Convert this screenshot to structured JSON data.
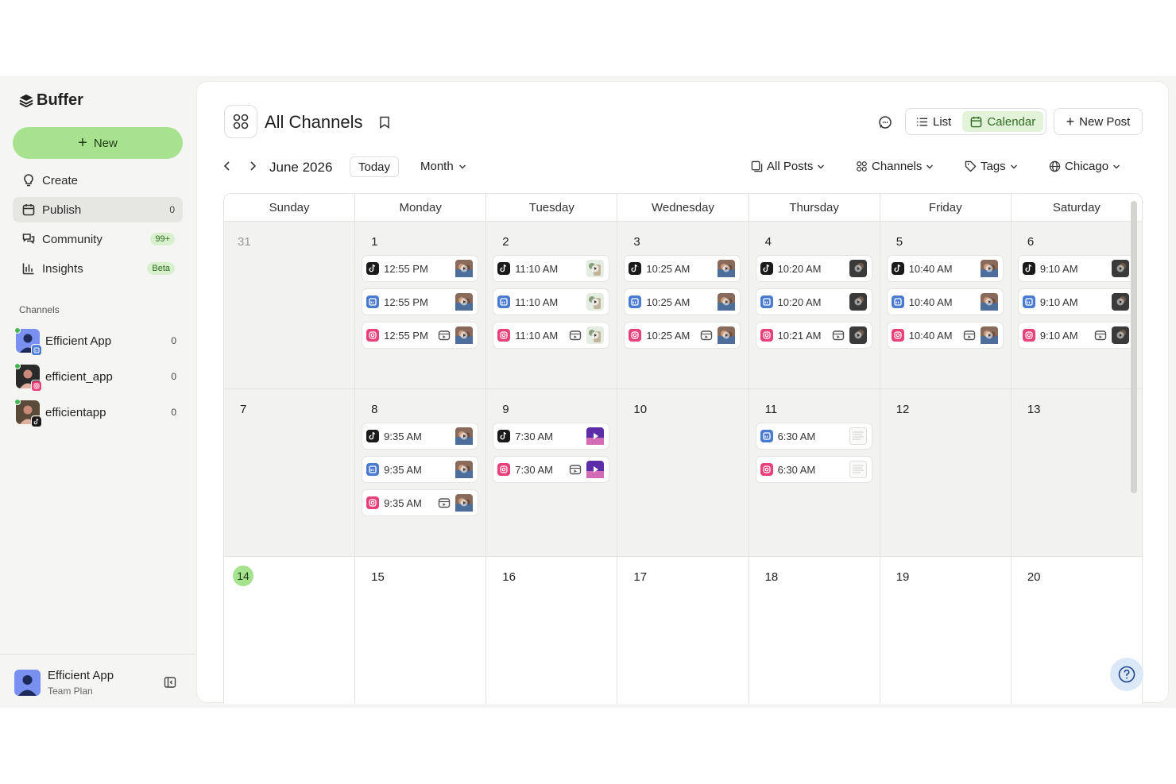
{
  "app": {
    "logo": "Buffer",
    "new_button": "New"
  },
  "nav": [
    {
      "label": "Create",
      "icon": "bulb-icon",
      "count": "",
      "badge": ""
    },
    {
      "label": "Publish",
      "icon": "calendar-icon",
      "count": "0",
      "badge": ""
    },
    {
      "label": "Community",
      "icon": "chat-bubbles-icon",
      "count": "",
      "badge": "99+"
    },
    {
      "label": "Insights",
      "icon": "bar-chart-icon",
      "count": "",
      "badge": "Beta"
    }
  ],
  "channels_title": "Channels",
  "channels": [
    {
      "name": "Efficient App",
      "count": "0",
      "network": "linkedin"
    },
    {
      "name": "efficient_app",
      "count": "0",
      "network": "instagram"
    },
    {
      "name": "efficientapp",
      "count": "0",
      "network": "tiktok"
    }
  ],
  "account": {
    "name": "Efficient App",
    "plan": "Team Plan"
  },
  "header": {
    "title": "All Channels",
    "view_list": "List",
    "view_calendar": "Calendar",
    "new_post": "New Post"
  },
  "toolbar": {
    "month": "June 2026",
    "today": "Today",
    "view": "Month",
    "all_posts": "All Posts",
    "channels": "Channels",
    "tags": "Tags",
    "timezone": "Chicago"
  },
  "colors": {
    "accent": "#a7e28f",
    "linkedin": "#4a7bd0",
    "instagram": "#e8407a",
    "tiktok": "#1a1a1a"
  },
  "weekdays": [
    "Sunday",
    "Monday",
    "Tuesday",
    "Wednesday",
    "Thursday",
    "Friday",
    "Saturday"
  ],
  "weeks": [
    {
      "state": "past",
      "days": [
        {
          "num": "31",
          "muted": true,
          "posts": []
        },
        {
          "num": "1",
          "posts": [
            {
              "net": "tiktok",
              "time": "12:55 PM",
              "reel": false,
              "thumb": "photo"
            },
            {
              "net": "linkedin",
              "time": "12:55 PM",
              "reel": false,
              "thumb": "photo"
            },
            {
              "net": "instagram",
              "time": "12:55 PM",
              "reel": true,
              "thumb": "photo"
            }
          ]
        },
        {
          "num": "2",
          "posts": [
            {
              "net": "tiktok",
              "time": "11:10 AM",
              "reel": false,
              "thumb": "photo2"
            },
            {
              "net": "linkedin",
              "time": "11:10 AM",
              "reel": false,
              "thumb": "photo2"
            },
            {
              "net": "instagram",
              "time": "11:10 AM",
              "reel": true,
              "thumb": "photo2"
            }
          ]
        },
        {
          "num": "3",
          "posts": [
            {
              "net": "tiktok",
              "time": "10:25 AM",
              "reel": false,
              "thumb": "photo"
            },
            {
              "net": "linkedin",
              "time": "10:25 AM",
              "reel": false,
              "thumb": "photo"
            },
            {
              "net": "instagram",
              "time": "10:25 AM",
              "reel": true,
              "thumb": "photo"
            }
          ]
        },
        {
          "num": "4",
          "posts": [
            {
              "net": "tiktok",
              "time": "10:20 AM",
              "reel": false,
              "thumb": "video"
            },
            {
              "net": "linkedin",
              "time": "10:20 AM",
              "reel": false,
              "thumb": "video"
            },
            {
              "net": "instagram",
              "time": "10:21 AM",
              "reel": true,
              "thumb": "video"
            }
          ]
        },
        {
          "num": "5",
          "posts": [
            {
              "net": "tiktok",
              "time": "10:40 AM",
              "reel": false,
              "thumb": "photo"
            },
            {
              "net": "linkedin",
              "time": "10:40 AM",
              "reel": false,
              "thumb": "photo"
            },
            {
              "net": "instagram",
              "time": "10:40 AM",
              "reel": true,
              "thumb": "photo"
            }
          ]
        },
        {
          "num": "6",
          "posts": [
            {
              "net": "tiktok",
              "time": "9:10 AM",
              "reel": false,
              "thumb": "video"
            },
            {
              "net": "linkedin",
              "time": "9:10 AM",
              "reel": false,
              "thumb": "video"
            },
            {
              "net": "instagram",
              "time": "9:10 AM",
              "reel": true,
              "thumb": "video"
            }
          ]
        }
      ]
    },
    {
      "state": "past",
      "days": [
        {
          "num": "7",
          "posts": []
        },
        {
          "num": "8",
          "posts": [
            {
              "net": "tiktok",
              "time": "9:35 AM",
              "reel": false,
              "thumb": "photo"
            },
            {
              "net": "linkedin",
              "time": "9:35 AM",
              "reel": false,
              "thumb": "photo"
            },
            {
              "net": "instagram",
              "time": "9:35 AM",
              "reel": true,
              "thumb": "photo"
            }
          ]
        },
        {
          "num": "9",
          "posts": [
            {
              "net": "tiktok",
              "time": "7:30 AM",
              "reel": false,
              "thumb": "purple"
            },
            {
              "net": "instagram",
              "time": "7:30 AM",
              "reel": true,
              "thumb": "purple"
            }
          ]
        },
        {
          "num": "10",
          "posts": []
        },
        {
          "num": "11",
          "posts": [
            {
              "net": "linkedin",
              "time": "6:30 AM",
              "reel": false,
              "thumb": "doc"
            },
            {
              "net": "instagram",
              "time": "6:30 AM",
              "reel": false,
              "thumb": "doc"
            }
          ]
        },
        {
          "num": "12",
          "posts": []
        },
        {
          "num": "13",
          "posts": []
        }
      ]
    },
    {
      "state": "cur",
      "days": [
        {
          "num": "14",
          "today": true,
          "posts": []
        },
        {
          "num": "15",
          "posts": []
        },
        {
          "num": "16",
          "posts": []
        },
        {
          "num": "17",
          "posts": []
        },
        {
          "num": "18",
          "posts": []
        },
        {
          "num": "19",
          "posts": []
        },
        {
          "num": "20",
          "posts": []
        }
      ]
    }
  ]
}
